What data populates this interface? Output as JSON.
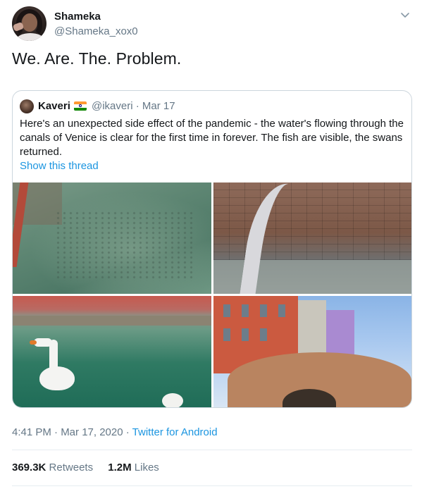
{
  "author": {
    "name": "Shameka",
    "handle": "@Shameka_xox0"
  },
  "tweet": {
    "text": "We. Are. The. Problem."
  },
  "quoted": {
    "name": "Kaveri",
    "meta": "@ikaveri · Mar 17",
    "text": "Here's an unexpected side effect of the pandemic - the water's flowing through the canals of Venice is clear for the first time in forever. The fish are visible, the swans returned.",
    "thread_link": "Show this thread",
    "flag_icon": "india-flag-icon"
  },
  "meta": {
    "timestamp": "4:41 PM · Mar 17, 2020",
    "separator": " · ",
    "source": "Twitter for Android"
  },
  "stats": {
    "retweets_count": "369.3K",
    "retweets_label": "Retweets",
    "likes_count": "1.2M",
    "likes_label": "Likes"
  },
  "colors": {
    "link": "#1b95e0",
    "secondary": "#657786",
    "border": "#ccd6dd"
  }
}
